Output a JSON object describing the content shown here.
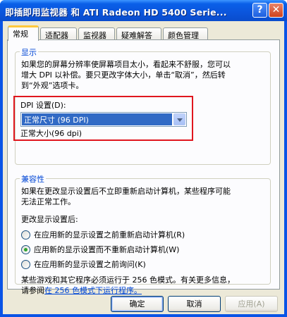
{
  "window": {
    "title": "即插即用监视器 和 ATI Radeon HD 5400 Serie...",
    "help_glyph": "?",
    "close_glyph": "✕"
  },
  "tabs": [
    {
      "label": "常规",
      "active": true
    },
    {
      "label": "适配器",
      "active": false
    },
    {
      "label": "监视器",
      "active": false
    },
    {
      "label": "疑难解答",
      "active": false
    },
    {
      "label": "颜色管理",
      "active": false
    }
  ],
  "display_group": {
    "label": "显示",
    "description_line1": "如果您的屏幕分辨率使屏幕项目太小，看起来不舒服，您可以",
    "description_line2": "增大 DPI 以补偿。要只更改字体大小，单击“取消”，然后转",
    "description_line3": "到“外观”选项卡。",
    "dpi_label": "DPI 设置(D):",
    "dpi_selected": "正常尺寸 (96 DPI)",
    "dpi_current": "正常大小(96 dpi)"
  },
  "compat_group": {
    "label": "兼容性",
    "description_line1": "如果在更改显示设置后不立即重新启动计算机，某些程序可能",
    "description_line2": "无法正常工作。",
    "after_change_label": "更改显示设置后:",
    "options": [
      {
        "label": "在应用新的显示设置之前重新启动计算机(R)",
        "checked": false
      },
      {
        "label": "应用新的显示设置而不重新启动计算机(W)",
        "checked": true
      },
      {
        "label": "在应用新的显示设置之前询问(K)",
        "checked": false
      }
    ],
    "note_line1": "某些游戏和其它程序必须运行于 256 色模式。有关更多信息，",
    "note_prefix": "请参阅",
    "note_link": "在 256 色模式下运行程序。"
  },
  "buttons": {
    "ok": "确定",
    "cancel": "取消",
    "apply": "应用(A)"
  },
  "colors": {
    "title_bar": "#0a54e6",
    "dialog_bg": "#ece9d8",
    "group_label": "#0046d5",
    "highlight_box": "#e0161e",
    "selection": "#316ac5"
  }
}
